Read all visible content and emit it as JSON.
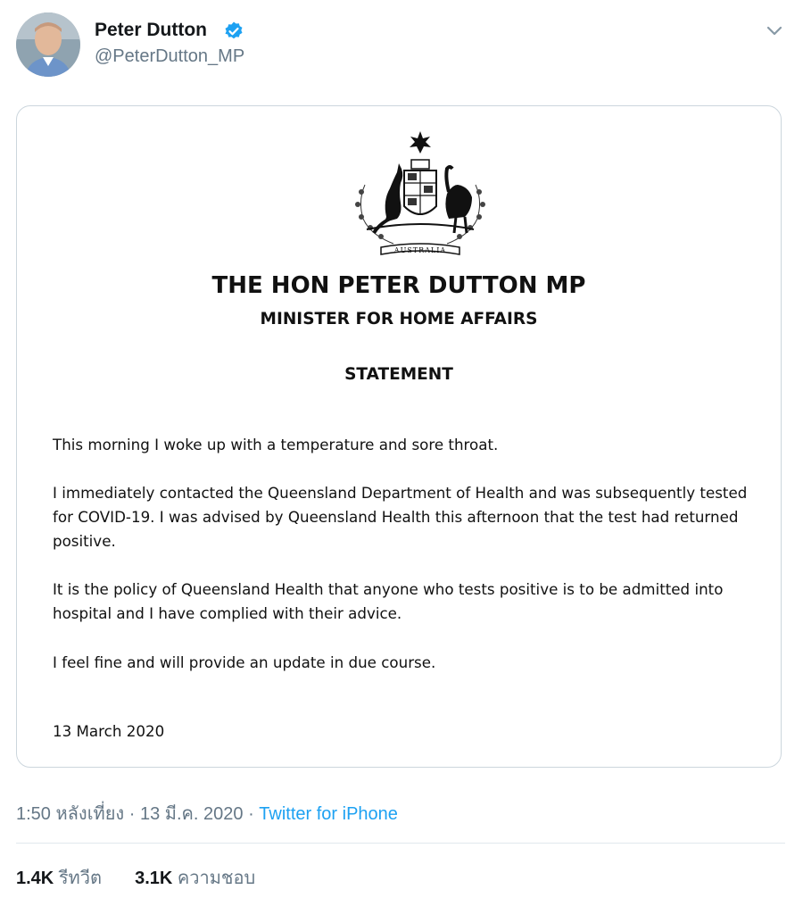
{
  "tweet": {
    "author": {
      "display_name": "Peter Dutton",
      "handle": "@PeterDutton_MP",
      "verified": true
    },
    "attachment": {
      "title": "THE HON PETER DUTTON MP",
      "subtitle": "MINISTER FOR HOME AFFAIRS",
      "heading": "STATEMENT",
      "paragraphs": [
        "This morning I woke up with a temperature and sore throat.",
        "I immediately contacted the Queensland Department of Health and was subsequently tested for COVID-19. I was advised by Queensland Health this afternoon that the test had returned positive.",
        "It is the policy of Queensland Health that anyone who tests positive is to be admitted into hospital and I have complied with their advice.",
        "I feel fine and will provide an update in due course."
      ],
      "date": "13 March 2020",
      "emblem_text": "AUSTRALIA"
    },
    "meta": {
      "time": "1:50 หลังเที่ยง",
      "separator": " · ",
      "date": "13 มี.ค. 2020",
      "source": "Twitter for iPhone"
    },
    "stats": {
      "retweets_count": "1.4K",
      "retweets_label": "รีทวีต",
      "likes_count": "3.1K",
      "likes_label": "ความชอบ"
    }
  },
  "colors": {
    "accent": "#1da1f2",
    "text_primary": "#14171a",
    "text_secondary": "#657786",
    "border": "#ccd6dd"
  },
  "icons": {
    "verified": "verified-badge-icon",
    "menu": "chevron-down-icon",
    "emblem": "coat-of-arms-icon"
  }
}
